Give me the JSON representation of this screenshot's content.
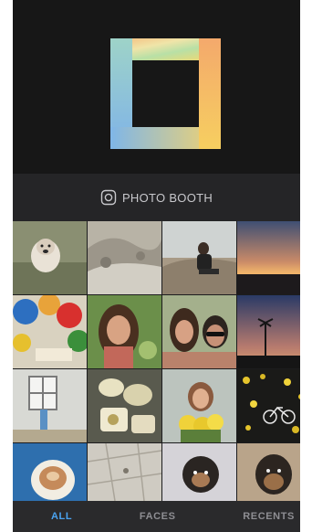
{
  "app": {
    "photo_booth_label": "PHOTO BOOTH",
    "camera_icon": "camera-icon",
    "logo": "layout-logo"
  },
  "photos": [
    {
      "label": "dog-on-grass"
    },
    {
      "label": "rocky-hillside"
    },
    {
      "label": "person-on-beach-rocks"
    },
    {
      "label": "sunset-horizon"
    },
    {
      "label": "colorful-balloons"
    },
    {
      "label": "woman-selfie"
    },
    {
      "label": "couple-selfie"
    },
    {
      "label": "palm-trees-dusk"
    },
    {
      "label": "white-house-window"
    },
    {
      "label": "plate-of-food"
    },
    {
      "label": "woman-with-flowers"
    },
    {
      "label": "yellow-leaves-bike"
    },
    {
      "label": "coffee-cup"
    },
    {
      "label": "tiled-floor"
    },
    {
      "label": "dog-on-bed"
    },
    {
      "label": "dog-portrait"
    }
  ],
  "tabs": [
    {
      "label": "ALL",
      "active": true
    },
    {
      "label": "FACES",
      "active": false
    },
    {
      "label": "RECENTS",
      "active": false
    }
  ],
  "colors": {
    "accent": "#4aa3f0",
    "background": "#1c1c1e",
    "inactive_tab": "#8e8e93"
  }
}
